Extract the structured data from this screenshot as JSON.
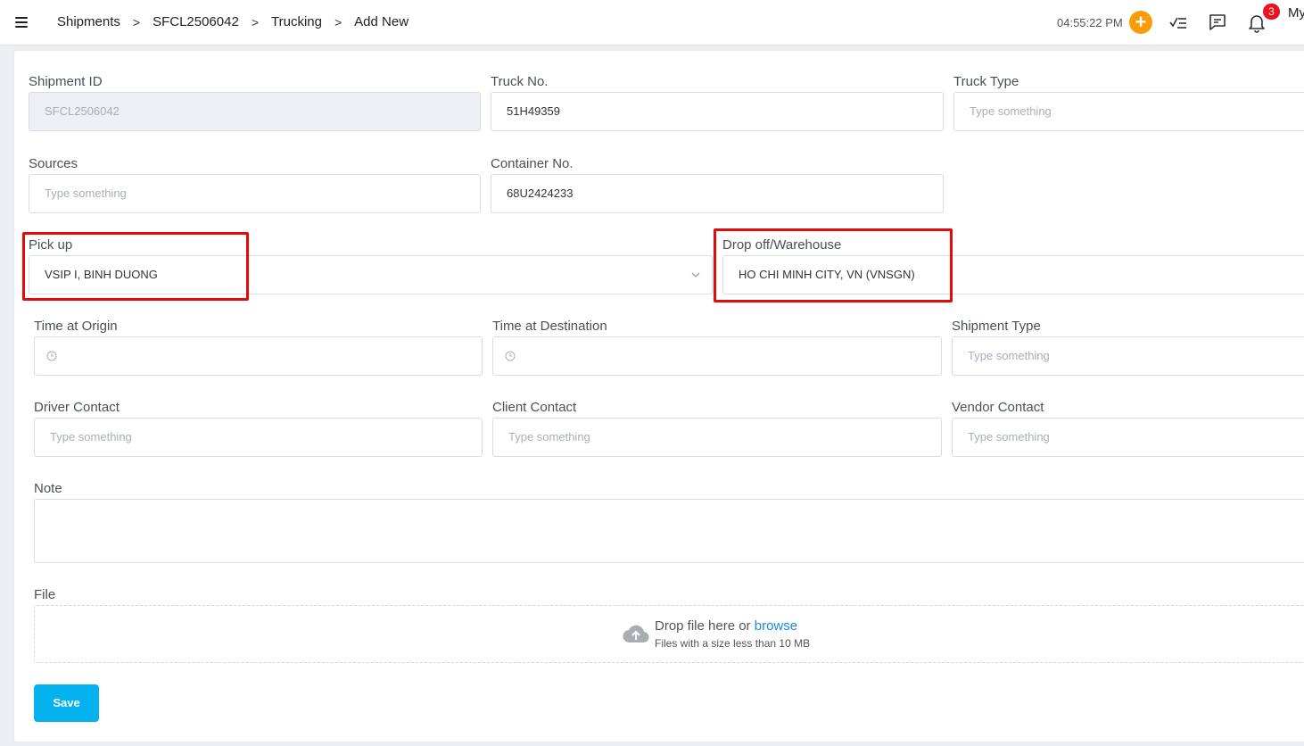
{
  "breadcrumb": [
    "Shipments",
    "SFCL2506042",
    "Trucking",
    "Add New"
  ],
  "breadcrumb_separator": ">",
  "header": {
    "time": "04:55:22 PM",
    "add_label": "+",
    "notification_count": "3",
    "user_label": "My",
    "accent_color": "#fb9b0b",
    "badge_color": "#e9121d"
  },
  "form": {
    "shipment_id": {
      "label": "Shipment ID",
      "value": "SFCL2506042"
    },
    "truck_no": {
      "label": "Truck No.",
      "value": "51H49359"
    },
    "truck_type": {
      "label": "Truck Type",
      "placeholder": "Type something"
    },
    "sources": {
      "label": "Sources",
      "placeholder": "Type something"
    },
    "container_no": {
      "label": "Container No.",
      "value": "68U2424233"
    },
    "pick_up": {
      "label": "Pick up",
      "value": "VSIP I, BINH DUONG"
    },
    "drop_off": {
      "label": "Drop off/Warehouse",
      "value": "HO CHI MINH CITY, VN (VNSGN)"
    },
    "time_origin": {
      "label": "Time at Origin"
    },
    "time_destination": {
      "label": "Time at Destination"
    },
    "shipment_type": {
      "label": "Shipment Type",
      "placeholder": "Type something"
    },
    "driver_contact": {
      "label": "Driver Contact",
      "placeholder": "Type something"
    },
    "client_contact": {
      "label": "Client Contact",
      "placeholder": "Type something"
    },
    "vendor_contact": {
      "label": "Vendor Contact",
      "placeholder": "Type something"
    },
    "note": {
      "label": "Note"
    },
    "file": {
      "label": "File",
      "drop_text": "Drop file here or",
      "browse": "browse",
      "hint": "Files with a size less than 10 MB"
    },
    "save_label": "Save"
  },
  "colors": {
    "primary_button": "#05b2f0",
    "highlight": "#e20b0b",
    "link": "#1e88e5"
  }
}
